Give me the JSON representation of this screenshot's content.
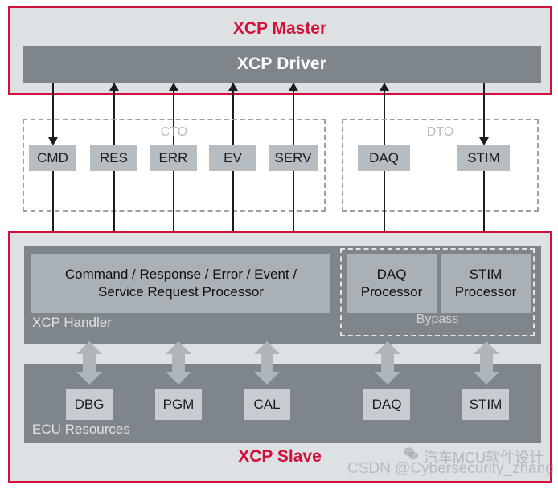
{
  "master": {
    "title": "XCP Master",
    "driver_label": "XCP Driver"
  },
  "packet_groups": [
    {
      "label": "CTO",
      "chips": [
        "CMD",
        "RES",
        "ERR",
        "EV",
        "SERV"
      ]
    },
    {
      "label": "DTO",
      "chips": [
        "DAQ",
        "STIM"
      ]
    }
  ],
  "slave": {
    "title": "XCP Slave",
    "handler_label": "XCP Handler",
    "bypass_label": "Bypass",
    "ecu_label": "ECU Resources",
    "processors": {
      "main": "Command / Response / Error / Event / Service Request Processor",
      "main_line1": "Command / Response / Error / Event /",
      "main_line2": "Service Request Processor",
      "daq_line1": "DAQ",
      "daq_line2": "Processor",
      "stim_line1": "STIM",
      "stim_line2": "Processor"
    },
    "resources": [
      "DBG",
      "PGM",
      "CAL",
      "DAQ",
      "STIM"
    ]
  },
  "watermark": {
    "csdn": "CSDN @Cybersecurity_zhang",
    "wechat": "汽车MCU软件设计"
  },
  "colors": {
    "accent_red": "#d2103c",
    "panel_bg": "#dde1e4",
    "dark_bar": "#7f868b",
    "chip_bg": "#b6bdc2",
    "arrow_grey": "#aeb5bb",
    "label_grey": "#b9bec3"
  }
}
